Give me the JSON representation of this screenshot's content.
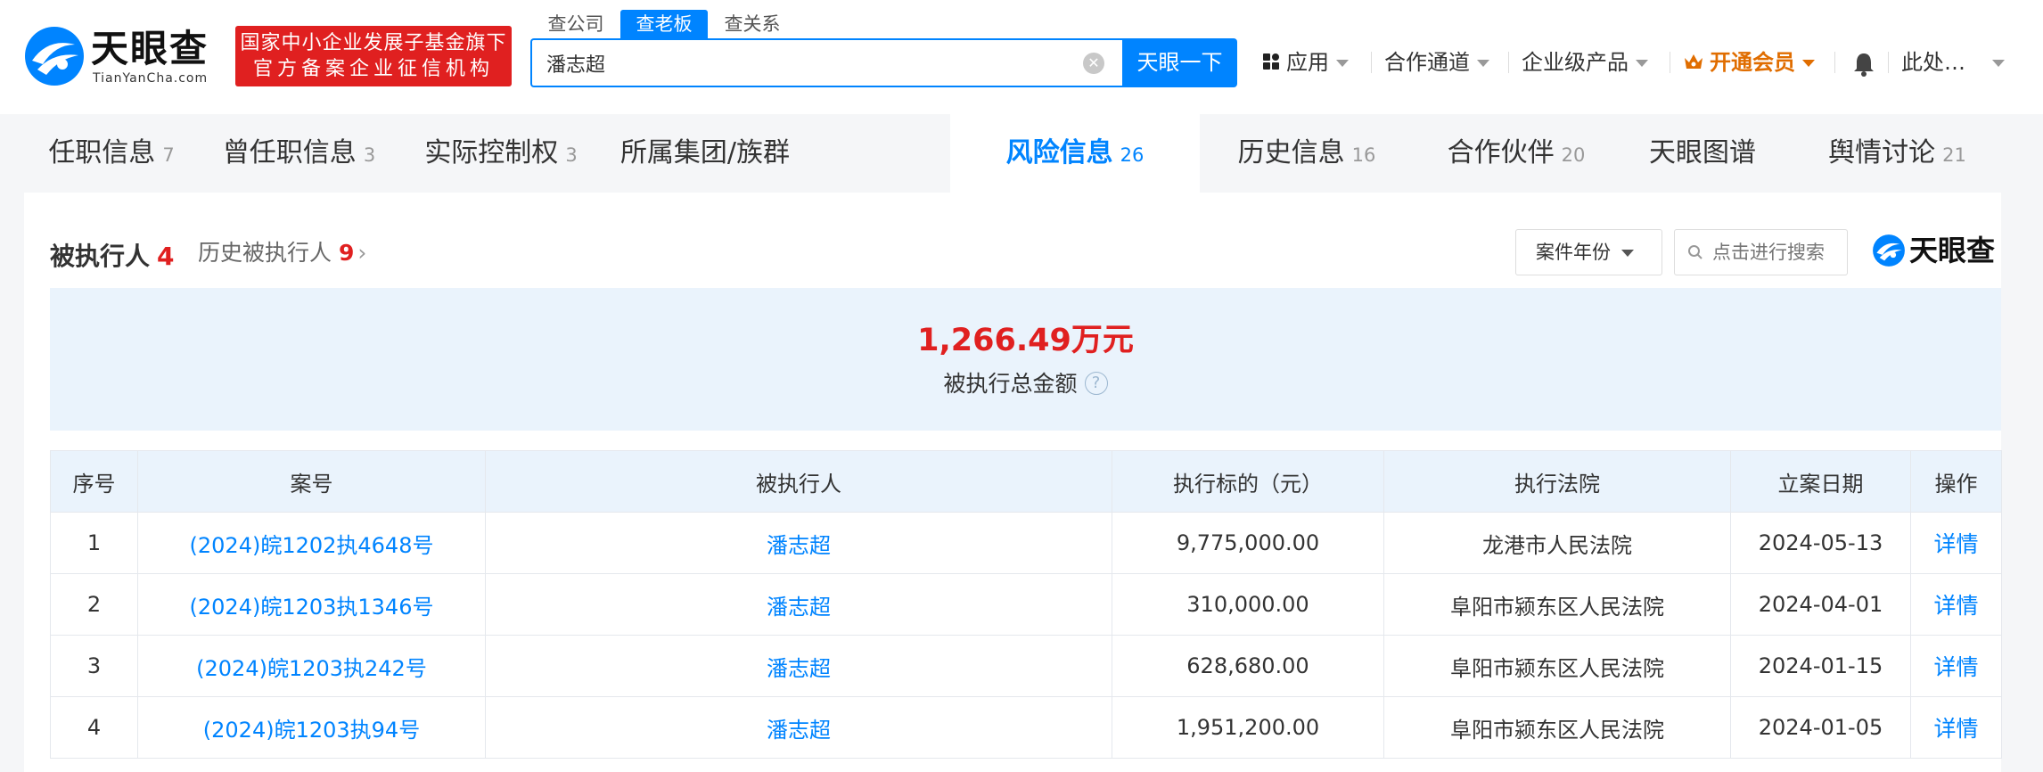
{
  "header": {
    "logo_name": "天眼查",
    "logo_domain": "TianYanCha.com",
    "slogan_line1": "国家中小企业发展子基金旗下",
    "slogan_line2": "官方备案企业征信机构",
    "search_tabs": [
      "查公司",
      "查老板",
      "查关系"
    ],
    "search_value": "潘志超",
    "search_button": "天眼一下",
    "nav": {
      "apps": "应用",
      "cooperation": "合作通道",
      "enterprise": "企业级产品",
      "vip": "开通会员",
      "user": "此处…"
    },
    "colors": {
      "brand_blue": "#0084ff",
      "slogan_red": "#e02020",
      "vip_orange": "#e06d00"
    }
  },
  "tabs": [
    {
      "label": "任职信息",
      "count": "7"
    },
    {
      "label": "曾任职信息",
      "count": "3"
    },
    {
      "label": "实际控制权",
      "count": "3"
    },
    {
      "label": "所属集团/族群",
      "count": ""
    },
    {
      "label": "风险信息",
      "count": "26"
    },
    {
      "label": "历史信息",
      "count": "16"
    },
    {
      "label": "合作伙伴",
      "count": "20"
    },
    {
      "label": "天眼图谱",
      "count": ""
    },
    {
      "label": "舆情讨论",
      "count": "21"
    }
  ],
  "active_tab": "风险信息",
  "section": {
    "title": "被执行人",
    "count": "4",
    "history_label": "历史被执行人",
    "history_count": "9",
    "year_filter": "案件年份",
    "search_placeholder": "点击进行搜索",
    "brand": "天眼查"
  },
  "summary": {
    "amount": "1,266.49万元",
    "label": "被执行总金额",
    "help": "?"
  },
  "table": {
    "columns": [
      "序号",
      "案号",
      "被执行人",
      "执行标的（元）",
      "执行法院",
      "立案日期",
      "操作"
    ],
    "rows": [
      {
        "no": "1",
        "case": "(2024)皖1202执4648号",
        "person": "潘志超",
        "amount": "9,775,000.00",
        "court": "龙港市人民法院",
        "date": "2024-05-13",
        "action": "详情"
      },
      {
        "no": "2",
        "case": "(2024)皖1203执1346号",
        "person": "潘志超",
        "amount": "310,000.00",
        "court": "阜阳市颍东区人民法院",
        "date": "2024-04-01",
        "action": "详情"
      },
      {
        "no": "3",
        "case": "(2024)皖1203执242号",
        "person": "潘志超",
        "amount": "628,680.00",
        "court": "阜阳市颍东区人民法院",
        "date": "2024-01-15",
        "action": "详情"
      },
      {
        "no": "4",
        "case": "(2024)皖1203执94号",
        "person": "潘志超",
        "amount": "1,951,200.00",
        "court": "阜阳市颍东区人民法院",
        "date": "2024-01-05",
        "action": "详情"
      }
    ]
  }
}
